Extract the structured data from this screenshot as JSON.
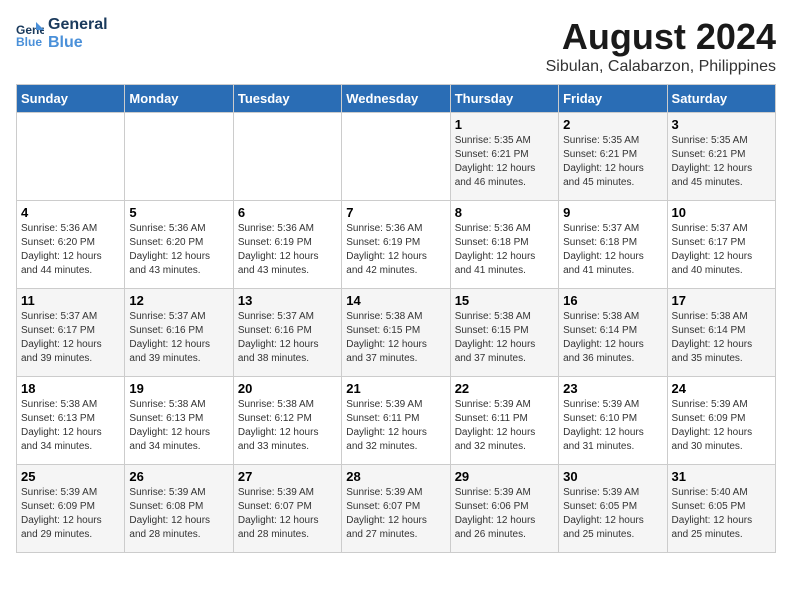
{
  "logo": {
    "line1": "General",
    "line2": "Blue"
  },
  "title": "August 2024",
  "subtitle": "Sibulan, Calabarzon, Philippines",
  "days_of_week": [
    "Sunday",
    "Monday",
    "Tuesday",
    "Wednesday",
    "Thursday",
    "Friday",
    "Saturday"
  ],
  "weeks": [
    [
      {
        "day": "",
        "info": ""
      },
      {
        "day": "",
        "info": ""
      },
      {
        "day": "",
        "info": ""
      },
      {
        "day": "",
        "info": ""
      },
      {
        "day": "1",
        "info": "Sunrise: 5:35 AM\nSunset: 6:21 PM\nDaylight: 12 hours\nand 46 minutes."
      },
      {
        "day": "2",
        "info": "Sunrise: 5:35 AM\nSunset: 6:21 PM\nDaylight: 12 hours\nand 45 minutes."
      },
      {
        "day": "3",
        "info": "Sunrise: 5:35 AM\nSunset: 6:21 PM\nDaylight: 12 hours\nand 45 minutes."
      }
    ],
    [
      {
        "day": "4",
        "info": "Sunrise: 5:36 AM\nSunset: 6:20 PM\nDaylight: 12 hours\nand 44 minutes."
      },
      {
        "day": "5",
        "info": "Sunrise: 5:36 AM\nSunset: 6:20 PM\nDaylight: 12 hours\nand 43 minutes."
      },
      {
        "day": "6",
        "info": "Sunrise: 5:36 AM\nSunset: 6:19 PM\nDaylight: 12 hours\nand 43 minutes."
      },
      {
        "day": "7",
        "info": "Sunrise: 5:36 AM\nSunset: 6:19 PM\nDaylight: 12 hours\nand 42 minutes."
      },
      {
        "day": "8",
        "info": "Sunrise: 5:36 AM\nSunset: 6:18 PM\nDaylight: 12 hours\nand 41 minutes."
      },
      {
        "day": "9",
        "info": "Sunrise: 5:37 AM\nSunset: 6:18 PM\nDaylight: 12 hours\nand 41 minutes."
      },
      {
        "day": "10",
        "info": "Sunrise: 5:37 AM\nSunset: 6:17 PM\nDaylight: 12 hours\nand 40 minutes."
      }
    ],
    [
      {
        "day": "11",
        "info": "Sunrise: 5:37 AM\nSunset: 6:17 PM\nDaylight: 12 hours\nand 39 minutes."
      },
      {
        "day": "12",
        "info": "Sunrise: 5:37 AM\nSunset: 6:16 PM\nDaylight: 12 hours\nand 39 minutes."
      },
      {
        "day": "13",
        "info": "Sunrise: 5:37 AM\nSunset: 6:16 PM\nDaylight: 12 hours\nand 38 minutes."
      },
      {
        "day": "14",
        "info": "Sunrise: 5:38 AM\nSunset: 6:15 PM\nDaylight: 12 hours\nand 37 minutes."
      },
      {
        "day": "15",
        "info": "Sunrise: 5:38 AM\nSunset: 6:15 PM\nDaylight: 12 hours\nand 37 minutes."
      },
      {
        "day": "16",
        "info": "Sunrise: 5:38 AM\nSunset: 6:14 PM\nDaylight: 12 hours\nand 36 minutes."
      },
      {
        "day": "17",
        "info": "Sunrise: 5:38 AM\nSunset: 6:14 PM\nDaylight: 12 hours\nand 35 minutes."
      }
    ],
    [
      {
        "day": "18",
        "info": "Sunrise: 5:38 AM\nSunset: 6:13 PM\nDaylight: 12 hours\nand 34 minutes."
      },
      {
        "day": "19",
        "info": "Sunrise: 5:38 AM\nSunset: 6:13 PM\nDaylight: 12 hours\nand 34 minutes."
      },
      {
        "day": "20",
        "info": "Sunrise: 5:38 AM\nSunset: 6:12 PM\nDaylight: 12 hours\nand 33 minutes."
      },
      {
        "day": "21",
        "info": "Sunrise: 5:39 AM\nSunset: 6:11 PM\nDaylight: 12 hours\nand 32 minutes."
      },
      {
        "day": "22",
        "info": "Sunrise: 5:39 AM\nSunset: 6:11 PM\nDaylight: 12 hours\nand 32 minutes."
      },
      {
        "day": "23",
        "info": "Sunrise: 5:39 AM\nSunset: 6:10 PM\nDaylight: 12 hours\nand 31 minutes."
      },
      {
        "day": "24",
        "info": "Sunrise: 5:39 AM\nSunset: 6:09 PM\nDaylight: 12 hours\nand 30 minutes."
      }
    ],
    [
      {
        "day": "25",
        "info": "Sunrise: 5:39 AM\nSunset: 6:09 PM\nDaylight: 12 hours\nand 29 minutes."
      },
      {
        "day": "26",
        "info": "Sunrise: 5:39 AM\nSunset: 6:08 PM\nDaylight: 12 hours\nand 28 minutes."
      },
      {
        "day": "27",
        "info": "Sunrise: 5:39 AM\nSunset: 6:07 PM\nDaylight: 12 hours\nand 28 minutes."
      },
      {
        "day": "28",
        "info": "Sunrise: 5:39 AM\nSunset: 6:07 PM\nDaylight: 12 hours\nand 27 minutes."
      },
      {
        "day": "29",
        "info": "Sunrise: 5:39 AM\nSunset: 6:06 PM\nDaylight: 12 hours\nand 26 minutes."
      },
      {
        "day": "30",
        "info": "Sunrise: 5:39 AM\nSunset: 6:05 PM\nDaylight: 12 hours\nand 25 minutes."
      },
      {
        "day": "31",
        "info": "Sunrise: 5:40 AM\nSunset: 6:05 PM\nDaylight: 12 hours\nand 25 minutes."
      }
    ]
  ]
}
